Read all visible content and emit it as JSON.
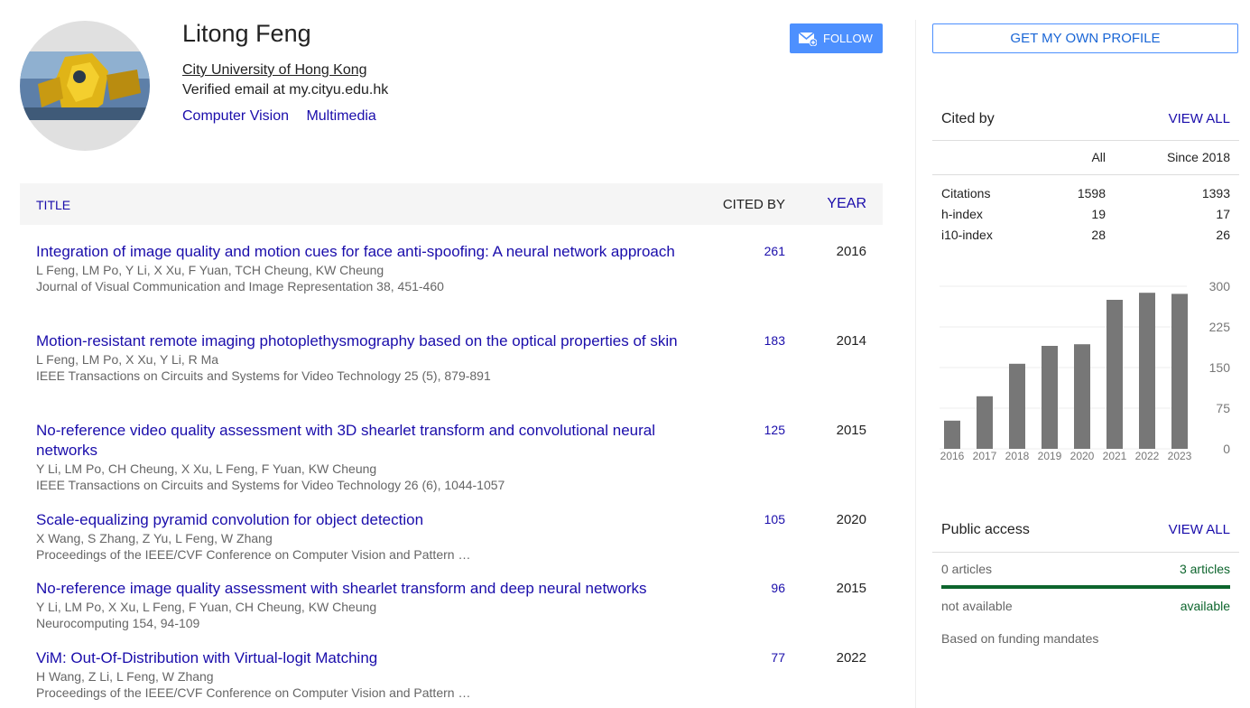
{
  "profile": {
    "name": "Litong Feng",
    "affiliation": "City University of Hong Kong",
    "email": "Verified email at my.cityu.edu.hk",
    "interests": [
      "Computer Vision",
      "Multimedia"
    ],
    "follow_label": "FOLLOW"
  },
  "table": {
    "col_title": "TITLE",
    "col_cited": "CITED BY",
    "col_year": "YEAR",
    "rows": [
      {
        "title": "Integration of image quality and motion cues for face anti-spoofing: A neural network approach",
        "authors": "L Feng, LM Po, Y Li, X Xu, F Yuan, TCH Cheung, KW Cheung",
        "venue": "Journal of Visual Communication and Image Representation 38, 451-460",
        "cites": "261",
        "year": "2016"
      },
      {
        "title": "Motion-resistant remote imaging photoplethysmography based on the optical properties of skin",
        "authors": "L Feng, LM Po, X Xu, Y Li, R Ma",
        "venue": "IEEE Transactions on Circuits and Systems for Video Technology 25 (5), 879-891",
        "cites": "183",
        "year": "2014"
      },
      {
        "title": "No-reference video quality assessment with 3D shearlet transform and convolutional neural networks",
        "authors": "Y Li, LM Po, CH Cheung, X Xu, L Feng, F Yuan, KW Cheung",
        "venue": "IEEE Transactions on Circuits and Systems for Video Technology 26 (6), 1044-1057",
        "cites": "125",
        "year": "2015"
      },
      {
        "title": "Scale-equalizing pyramid convolution for object detection",
        "authors": "X Wang, S Zhang, Z Yu, L Feng, W Zhang",
        "venue": "Proceedings of the IEEE/CVF Conference on Computer Vision and Pattern …",
        "cites": "105",
        "year": "2020"
      },
      {
        "title": "No-reference image quality assessment with shearlet transform and deep neural networks",
        "authors": "Y Li, LM Po, X Xu, L Feng, F Yuan, CH Cheung, KW Cheung",
        "venue": "Neurocomputing 154, 94-109",
        "cites": "96",
        "year": "2015"
      },
      {
        "title": "ViM: Out-Of-Distribution with Virtual-logit Matching",
        "authors": "H Wang, Z Li, L Feng, W Zhang",
        "venue": "Proceedings of the IEEE/CVF Conference on Computer Vision and Pattern …",
        "cites": "77",
        "year": "2022"
      }
    ]
  },
  "sidebar": {
    "get_profile_label": "GET MY OWN PROFILE",
    "cited_by": {
      "label": "Cited by",
      "view_all": "VIEW ALL",
      "col_all": "All",
      "col_since": "Since 2018",
      "rows": [
        {
          "metric": "Citations",
          "all": "1598",
          "since": "1393"
        },
        {
          "metric": "h-index",
          "all": "19",
          "since": "17"
        },
        {
          "metric": "i10-index",
          "all": "28",
          "since": "26"
        }
      ]
    },
    "public_access": {
      "label": "Public access",
      "view_all": "VIEW ALL",
      "not_available_count": "0 articles",
      "available_count": "3 articles",
      "not_available_label": "not available",
      "available_label": "available",
      "mandates": "Based on funding mandates",
      "available_color": "#0d652d"
    }
  },
  "chart_data": {
    "type": "bar",
    "categories": [
      "2016",
      "2017",
      "2018",
      "2019",
      "2020",
      "2021",
      "2022",
      "2023"
    ],
    "values": [
      52,
      97,
      157,
      190,
      193,
      275,
      288,
      286
    ],
    "yticks": [
      "300",
      "225",
      "150",
      "75",
      "0"
    ],
    "ylim": [
      0,
      300
    ],
    "bar_color": "#777777",
    "grid": true
  },
  "colors": {
    "link": "#1a0dab",
    "accent": "#4d90fe"
  }
}
